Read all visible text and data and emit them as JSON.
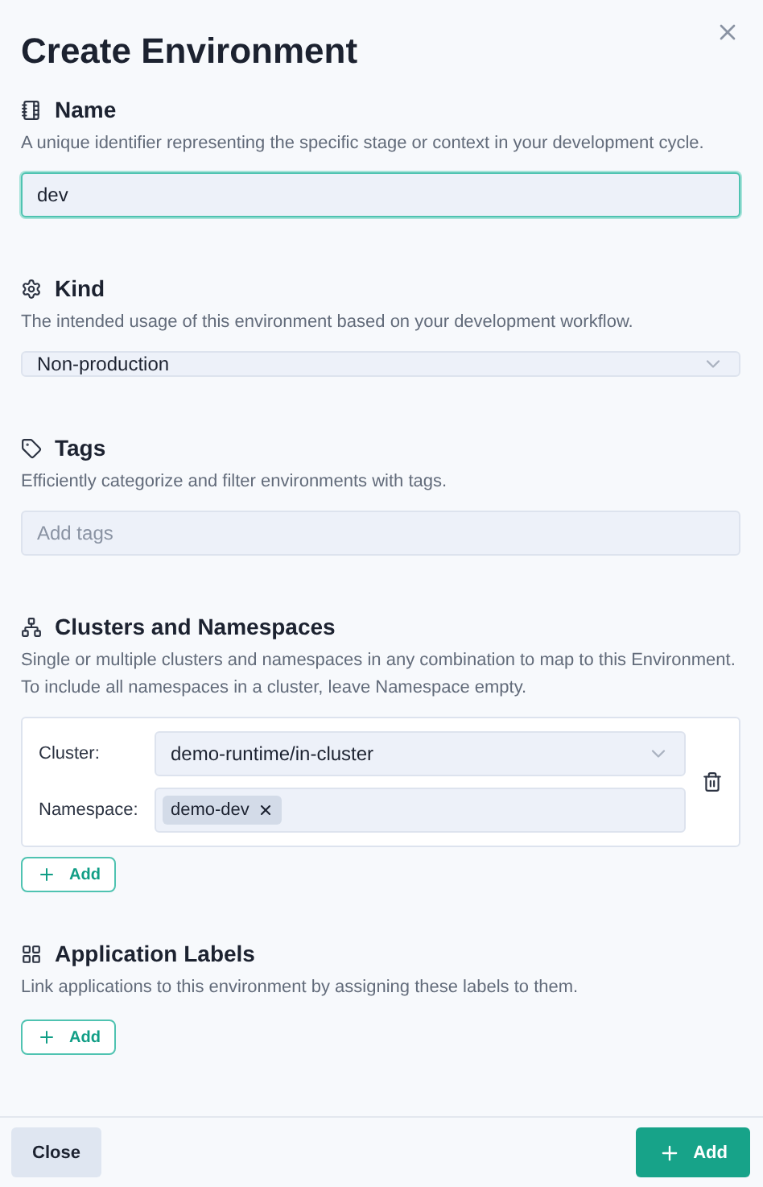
{
  "title": "Create Environment",
  "sections": [
    {
      "kind": "text",
      "label": "Name",
      "description": "A unique identifier representing the specific stage or context in your development cycle.",
      "value": "dev",
      "focused": true
    },
    {
      "kind": "select",
      "label": "Kind",
      "description": "The intended usage of this environment based on your development workflow.",
      "value": "Non-production"
    },
    {
      "kind": "tags",
      "label": "Tags",
      "description": "Efficiently categorize and filter environments with tags.",
      "placeholder": "Add tags"
    },
    {
      "kind": "clusters",
      "label": "Clusters and Namespaces",
      "description": "Single or multiple clusters and namespaces in any combination to map to this Environment. To include all namespaces in a cluster, leave Namespace empty.",
      "cluster_label": "Cluster:",
      "cluster_value": "demo-runtime/in-cluster",
      "namespace_label": "Namespace:",
      "namespaces": [
        "demo-dev"
      ],
      "add_label": "Add"
    },
    {
      "kind": "labels",
      "label": "Application Labels",
      "description": "Link applications to this environment by assigning these labels to them.",
      "add_label": "Add"
    }
  ],
  "footer": {
    "close": "Close",
    "submit": "Add"
  }
}
